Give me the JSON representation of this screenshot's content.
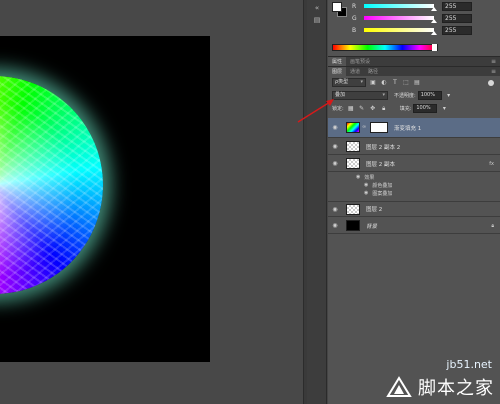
{
  "color_panel": {
    "channels": [
      {
        "label": "R",
        "value": "255",
        "gradient": [
          "#00ffff",
          "#ffffff"
        ]
      },
      {
        "label": "G",
        "value": "255",
        "gradient": [
          "#ff00ff",
          "#ffffff"
        ]
      },
      {
        "label": "B",
        "value": "255",
        "gradient": [
          "#ffff00",
          "#ffffff"
        ]
      }
    ]
  },
  "top_tabs": [
    "属性",
    "画笔预设"
  ],
  "layer_tabs": [
    "图层",
    "通道",
    "路径"
  ],
  "layers_toolbar": {
    "filter": "ρ类型",
    "blend_mode": "叠加",
    "opacity_label": "不透明度:",
    "opacity": "100%",
    "lock_label": "锁定:",
    "fill_label": "填充:",
    "fill": "100%"
  },
  "layers": [
    {
      "name": "渐变填充 1",
      "selected": true
    },
    {
      "name": "图层 2 副本 2",
      "selected": false
    },
    {
      "name": "图层 2 副本",
      "selected": false,
      "fx": "fx"
    },
    {
      "name": "图层 2",
      "selected": false
    },
    {
      "name": "背景",
      "selected": false
    }
  ],
  "effects": {
    "label": "效果",
    "items": [
      "颜色叠加",
      "图案叠加"
    ]
  },
  "watermark": {
    "site": "jb51.net",
    "name": "脚本之家"
  },
  "colors": {
    "selection": "#5b6c86",
    "arrow": "#d61a1a"
  }
}
